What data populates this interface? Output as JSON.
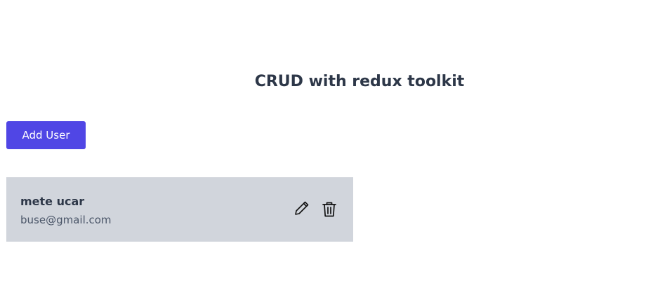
{
  "header": {
    "title": "CRUD with redux toolkit"
  },
  "toolbar": {
    "add_user_label": "Add User"
  },
  "users": [
    {
      "name": "mete ucar",
      "email": "buse@gmail.com",
      "actions": {
        "edit_icon": "pencil-icon",
        "delete_icon": "trash-icon"
      }
    }
  ],
  "colors": {
    "accent": "#5046e5",
    "card_background": "#d1d5dc",
    "title_text": "#2d3748"
  }
}
